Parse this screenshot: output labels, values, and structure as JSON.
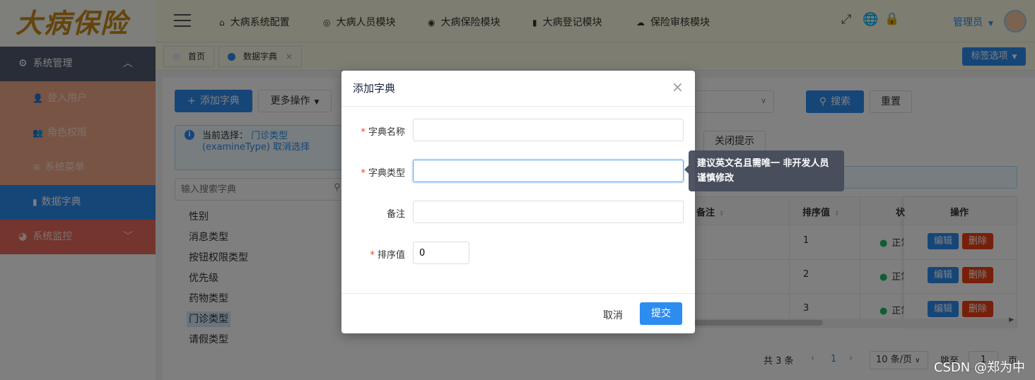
{
  "logo": "大病保险",
  "sidebar": {
    "groups": [
      {
        "label": "系统管理",
        "icon": "gear-icon",
        "expanded": true
      },
      {
        "label": "系统监控",
        "icon": "monitor-icon",
        "expanded": false
      }
    ],
    "items": [
      {
        "label": "登入用户",
        "icon": "user-icon"
      },
      {
        "label": "角色权限",
        "icon": "users-icon"
      },
      {
        "label": "系统菜单",
        "icon": "menu-icon"
      },
      {
        "label": "数据字典",
        "icon": "book-icon",
        "active": true
      }
    ]
  },
  "topnav": {
    "items": [
      {
        "label": "大病系统配置",
        "icon": "home-icon"
      },
      {
        "label": "大病人员模块",
        "icon": "settings-icon"
      },
      {
        "label": "大病保险模块",
        "icon": "record-icon"
      },
      {
        "label": "大病登记模块",
        "icon": "book-icon"
      },
      {
        "label": "保险审核模块",
        "icon": "cloud-icon"
      }
    ],
    "user": "管理员"
  },
  "tabs": {
    "items": [
      {
        "label": "首页"
      },
      {
        "label": "数据字典",
        "active": true
      }
    ],
    "options_label": "标签选项"
  },
  "toolbar": {
    "add_label": "添加字典",
    "more_label": "更多操作",
    "search_label": "搜索",
    "reset_label": "重置",
    "close_tip_label": "关闭提示"
  },
  "selection": {
    "prefix": "当前选择：",
    "value": "门诊类型(examineType)",
    "cancel": "取消选择"
  },
  "tree": {
    "search_placeholder": "输入搜索字典",
    "items": [
      "性别",
      "消息类型",
      "按钮权限类型",
      "优先级",
      "药物类型",
      "门诊类型",
      "请假类型"
    ],
    "selected_index": 5
  },
  "table": {
    "headers": [
      "备注",
      "排序值",
      "状",
      "操作"
    ],
    "rows": [
      {
        "order": "1",
        "status": "正常"
      },
      {
        "order": "2",
        "status": "正常"
      },
      {
        "order": "3",
        "status": "正常"
      }
    ],
    "edit_label": "编辑",
    "delete_label": "删除"
  },
  "pagination": {
    "total": "共 3 条",
    "current": "1",
    "page_size": "10 条/页",
    "goto": "跳至",
    "goto_value": "1",
    "page_suffix": "页"
  },
  "modal": {
    "title": "添加字典",
    "fields": [
      {
        "label": "字典名称",
        "required": true,
        "value": ""
      },
      {
        "label": "字典类型",
        "required": true,
        "value": ""
      },
      {
        "label": "备注",
        "required": false,
        "value": ""
      },
      {
        "label": "排序值",
        "required": true,
        "value": "0"
      }
    ],
    "cancel_label": "取消",
    "submit_label": "提交",
    "tooltip": "建议英文名且需唯一 非开发人员谨慎修改"
  },
  "watermark": "CSDN @郑为中",
  "colors": {
    "primary": "#2d8cf0",
    "sidebar_item": "#f0a889",
    "sidebar_active": "#2d8cf0",
    "sidebar_group": "#515a6e",
    "danger": "#ed4014"
  }
}
